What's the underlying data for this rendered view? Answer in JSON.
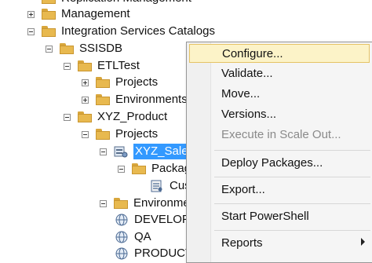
{
  "tree": {
    "cut_top": "Replication Management",
    "management": "Management",
    "catalogs": "Integration Services Catalogs",
    "ssisdb": "SSISDB",
    "etltest": "ETLTest",
    "projects1": "Projects",
    "environments1": "Environments",
    "xyz_product": "XYZ_Product",
    "projects2": "Projects",
    "xyz_sales": "XYZ_Sales",
    "packages": "Packages",
    "cus": "Cus",
    "environments2": "Environments",
    "developm": "DEVELOPM",
    "qa": "QA",
    "product": "PRODUCT"
  },
  "menu": {
    "configure": "Configure...",
    "validate": "Validate...",
    "move": "Move...",
    "versions": "Versions...",
    "execute_scale_out": "Execute in Scale Out...",
    "deploy_packages": "Deploy Packages...",
    "export": "Export...",
    "start_powershell": "Start PowerShell",
    "reports": "Reports"
  }
}
